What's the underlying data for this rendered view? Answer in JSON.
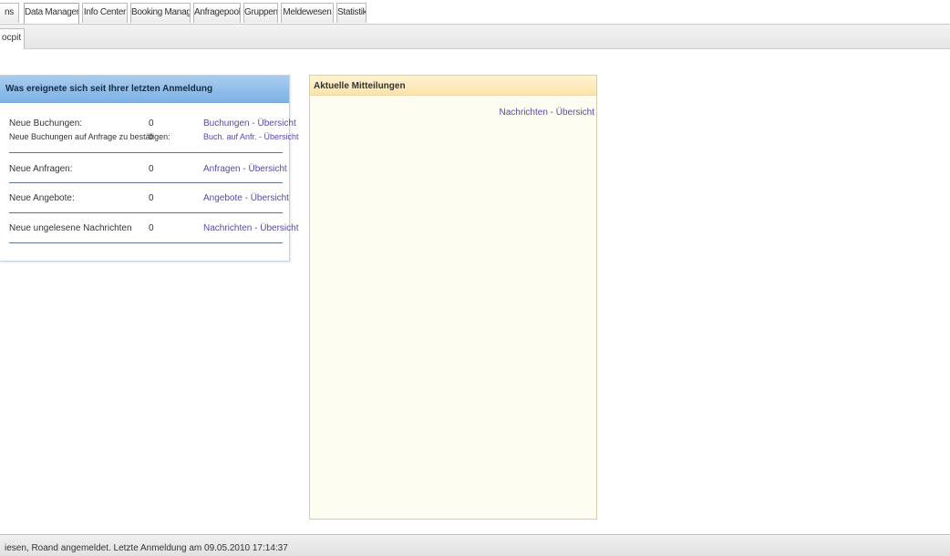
{
  "tabs": [
    {
      "label": "ns"
    },
    {
      "label": "Data Manager"
    },
    {
      "label": "Info Center"
    },
    {
      "label": "Booking Manager"
    },
    {
      "label": "Anfragepool"
    },
    {
      "label": "Gruppen"
    },
    {
      "label": "Meldewesen"
    },
    {
      "label": "Statistik"
    }
  ],
  "subtab": {
    "label": "ocpit"
  },
  "left_panel": {
    "title": "Was ereignete sich seit Ihrer letzten Anmeldung",
    "rows": [
      {
        "label": "Neue Buchungen:",
        "value": "0",
        "link": "Buchungen - Übersicht"
      },
      {
        "label": "Neue Buchungen auf Anfrage zu bestätigen:",
        "value": "0",
        "link": "Buch. auf Anfr. - Übersicht"
      },
      {
        "label": "Neue Anfragen:",
        "value": "0",
        "link": "Anfragen - Übersicht"
      },
      {
        "label": "Neue Angebote:",
        "value": "0",
        "link": "Angebote - Übersicht"
      },
      {
        "label": "Neue ungelesene Nachrichten",
        "value": "0",
        "link": "Nachrichten - Übersicht"
      }
    ]
  },
  "right_panel": {
    "title": "Aktuelle Mitteilungen",
    "link": "Nachrichten - Übersicht"
  },
  "status": {
    "text": "iesen, Roand angemeldet. Letzte Anmeldung am 09.05.2010 17:14:37"
  },
  "colors": {
    "left_header": "#7db1e4",
    "right_header": "#fde3ab",
    "link": "#5a47a8"
  }
}
